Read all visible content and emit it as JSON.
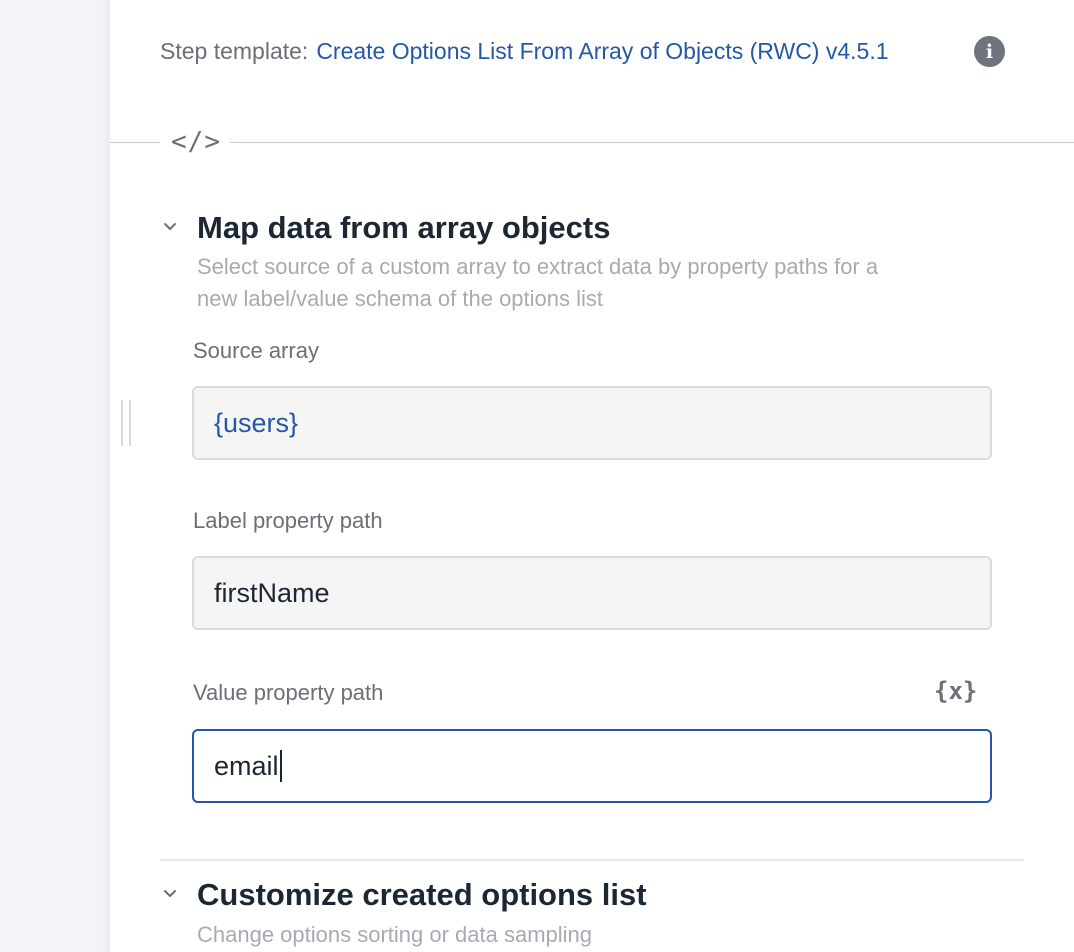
{
  "step_template": {
    "prefix": "Step template:",
    "link_text": "Create Options List From Array of Objects (RWC) v4.5.1",
    "info_icon": "info-icon"
  },
  "divider": {
    "code_glyph": "</>"
  },
  "map_section": {
    "title": "Map data from array objects",
    "description_line1": "Select source of a custom array to extract data by property paths for a",
    "description_line2": "new label/value schema of the options list",
    "source_array": {
      "label": "Source array",
      "value": "{users}"
    },
    "label_path": {
      "label": "Label property path",
      "value": "firstName"
    },
    "value_path": {
      "label": "Value property path",
      "value": "email",
      "variable_button": "{x}"
    }
  },
  "customize_section": {
    "title": "Customize created options list",
    "description": "Change options sorting or data sampling"
  },
  "colors": {
    "accent": "#2458a6",
    "title": "#1c2733",
    "muted": "#a7abb1",
    "label": "#6b6f76"
  }
}
